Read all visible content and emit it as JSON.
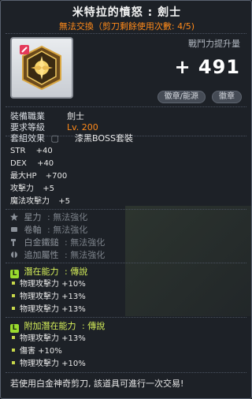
{
  "item": {
    "name": "米特拉的憤怒 : 劍士",
    "trade_note": "無法交換（剪刀剩餘使用次數: 4/5)",
    "power_label": "戰鬥力提升量",
    "power_value": "+ 491",
    "buttons": [
      "徽章/能源",
      "徽章"
    ]
  },
  "requirements": {
    "job_label": "裝備職業",
    "job_value": "劍士",
    "level_label": "要求等級",
    "level_value": "Lv. 200"
  },
  "set_effect": {
    "label": "套組效果",
    "value": "漆黑BOSS套裝"
  },
  "stats": [
    {
      "name": "STR",
      "value": "+40"
    },
    {
      "name": "DEX",
      "value": "+40"
    },
    {
      "name": "最大HP",
      "value": "+700"
    },
    {
      "name": "攻擊力",
      "value": "+5"
    },
    {
      "name": "魔法攻擊力",
      "value": "+5"
    }
  ],
  "enhancements": [
    {
      "icon": "star-icon",
      "label": "星力",
      "value": ": 無法強化"
    },
    {
      "icon": "scroll-icon",
      "label": "卷軸",
      "value": ": 無法強化"
    },
    {
      "icon": "hammer-icon",
      "label": "白金鐵鎚",
      "value": ": 無法強化"
    },
    {
      "icon": "wrench-icon",
      "label": "追加屬性",
      "value": ": 無法強化"
    }
  ],
  "potential": {
    "badge": "L",
    "label": "潛在能力",
    "grade": ": 傳說",
    "lines": [
      "物理攻擊力 +10%",
      "物理攻擊力 +13%",
      "物理攻擊力 +13%"
    ]
  },
  "additional_potential": {
    "badge": "L",
    "label": "附加潛在能力",
    "grade": ": 傳說",
    "lines": [
      "物理攻擊力 +13%",
      "傷害 +10%",
      "物理攻擊力 +10%"
    ]
  },
  "footer": "若使用白金神奇剪刀, 該道具可進行一次交易!",
  "colors": {
    "accent_orange": "#ff8a1a",
    "legend_green": "#9adb2e",
    "line_yellow": "#d7f05a"
  }
}
